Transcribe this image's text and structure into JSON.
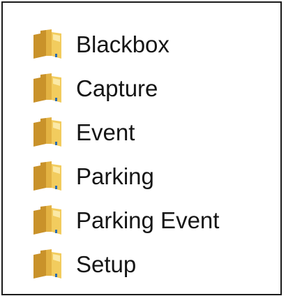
{
  "folders": [
    {
      "label": "Blackbox",
      "icon": "folder-icon"
    },
    {
      "label": "Capture",
      "icon": "folder-icon"
    },
    {
      "label": "Event",
      "icon": "folder-icon"
    },
    {
      "label": "Parking",
      "icon": "folder-icon"
    },
    {
      "label": "Parking Event",
      "icon": "folder-icon"
    },
    {
      "label": "Setup",
      "icon": "folder-icon"
    }
  ],
  "colors": {
    "folder_back": "#c9922a",
    "folder_front": "#f2cc5e",
    "folder_highlight": "#fbe9a6",
    "folder_accent": "#2b6cb0",
    "text": "#151515",
    "border": "#1a1a1a"
  }
}
